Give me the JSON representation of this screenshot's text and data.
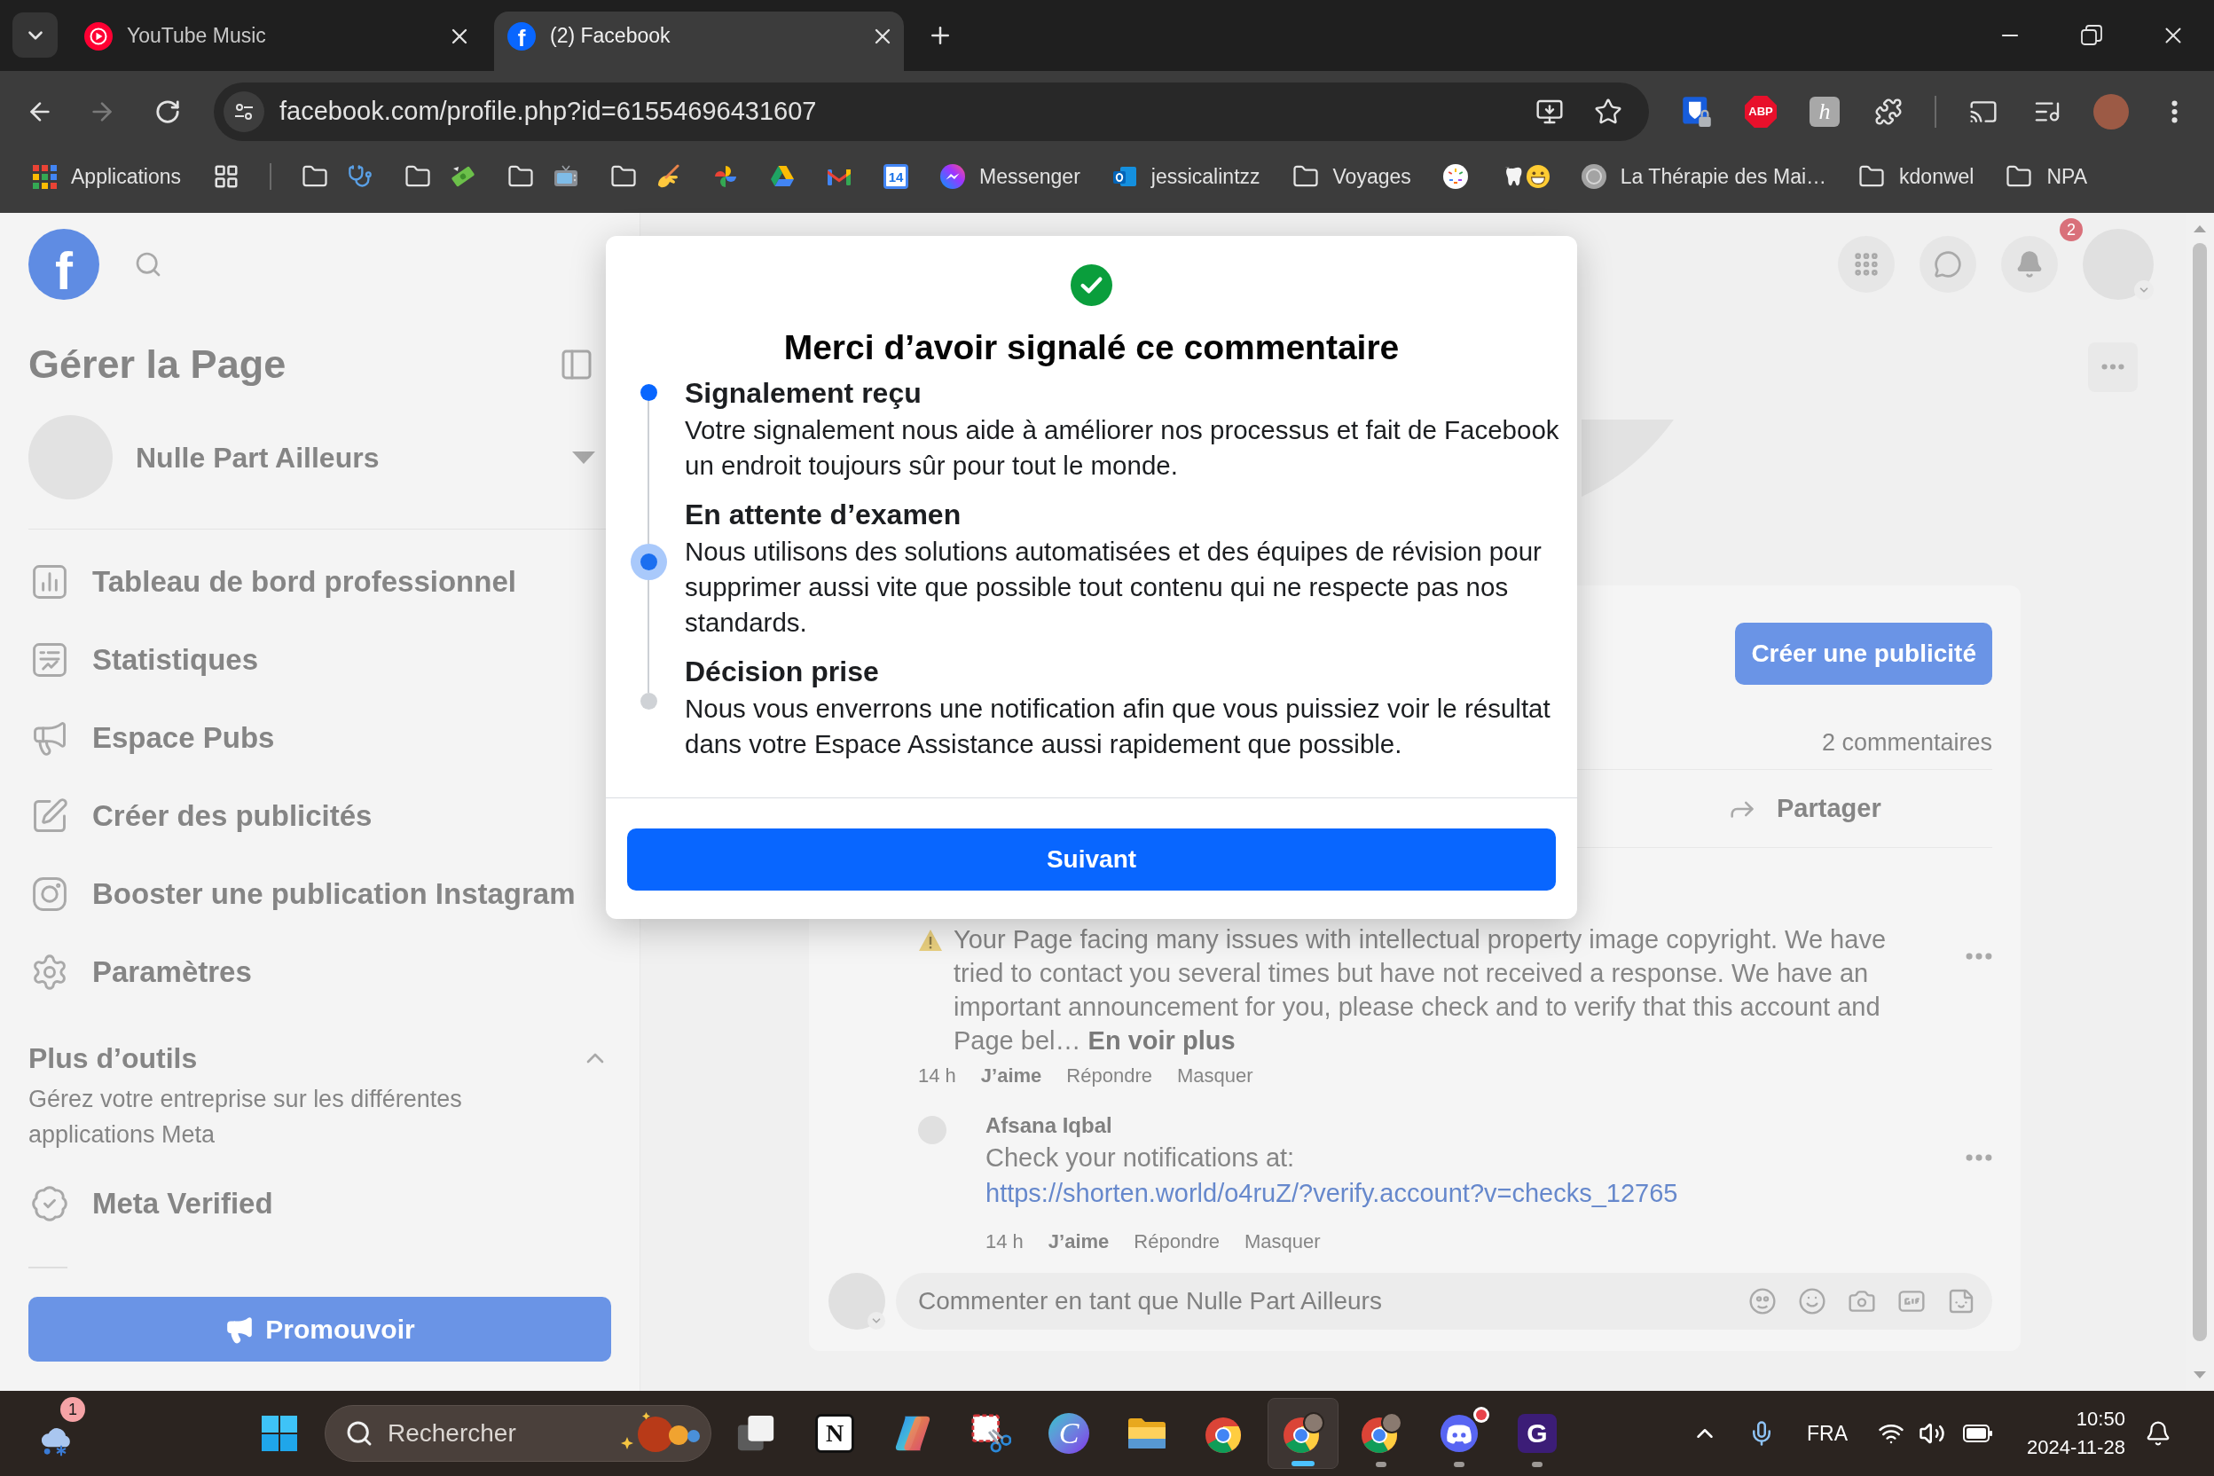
{
  "browser": {
    "tabs": [
      {
        "title": "YouTube Music",
        "selected": false
      },
      {
        "title": "(2) Facebook",
        "selected": true,
        "glyph": "f"
      }
    ],
    "forward": {
      "disabled": true
    },
    "url": "facebook.com/profile.php?id=61554696431607",
    "extensions": [
      {
        "kind": "vault"
      },
      {
        "kind": "octagon",
        "glyph": "ABP"
      },
      {
        "kind": "tile",
        "glyph": "h"
      },
      {
        "kind": "puzzle"
      }
    ],
    "bookmarks": [
      {
        "kind": "apps",
        "label": "Applications"
      },
      {
        "kind": "groups"
      },
      {
        "kind": "separator"
      },
      {
        "kind": "folder"
      },
      {
        "kind": "folder"
      },
      {
        "kind": "folder"
      },
      {
        "kind": "folder"
      },
      {
        "kind": "site"
      },
      {
        "kind": "site"
      },
      {
        "kind": "site"
      },
      {
        "kind": "site",
        "glyph": "14"
      },
      {
        "kind": "site",
        "label": "Messenger"
      },
      {
        "kind": "site",
        "label": "jessicalintzz"
      },
      {
        "kind": "folder",
        "label": "Voyages"
      },
      {
        "kind": "site"
      },
      {
        "kind": "site"
      },
      {
        "kind": "site",
        "label": "La Thérapie des Mai…"
      },
      {
        "kind": "folder",
        "label": "kdonwel"
      },
      {
        "kind": "folder",
        "label": "NPA"
      }
    ]
  },
  "page": {
    "sidebar": {
      "logo_glyph": "f",
      "title": "Gérer la Page",
      "page_name": "Nulle Part Ailleurs",
      "items": [
        "Tableau de bord professionnel",
        "Statistiques",
        "Espace Pubs",
        "Créer des publicités",
        "Booster une publication Instagram",
        "Paramètres"
      ],
      "more_tools": {
        "title": "Plus d’outils",
        "expanded": true,
        "description": "Gérez votre entreprise sur les différentes applications Meta",
        "items": [
          "Meta Verified"
        ]
      },
      "promote_button": "Promouvoir"
    },
    "header": {
      "notification_count": "2"
    },
    "post": {
      "create_ad_button": "Créer une publicité",
      "comment_count": "2 commentaires",
      "share_button": "Partager",
      "comments": [
        {
          "text": "Your Page facing many issues with intellectual property image copyright. We have tried to contact you several times but have not received a response. We have an important announcement for you, please check and to verify that this account and Page bel…",
          "see_more": "En voir plus",
          "time": "14 h",
          "actions": [
            "J’aime",
            "Répondre",
            "Masquer"
          ],
          "replies": [
            {
              "author": "Afsana Iqbal",
              "text": "Check your notifications at:",
              "link": "https://shorten.world/o4ruZ/?verify.account?v=checks_12765",
              "time": "14 h",
              "actions": [
                "J’aime",
                "Répondre",
                "Masquer"
              ]
            }
          ]
        }
      ],
      "composer": {
        "placeholder": "Commenter en tant que Nulle Part Ailleurs"
      }
    }
  },
  "dialog": {
    "title": "Merci d’avoir signalé ce commentaire",
    "steps": [
      {
        "title": "Signalement reçu",
        "body": "Votre signalement nous aide à améliorer nos processus et fait de Facebook un endroit toujours sûr pour tout le monde.",
        "completed": true,
        "current": false
      },
      {
        "title": "En attente d’examen",
        "body": "Nous utilisons des solutions automatisées et des équipes de révision pour supprimer aussi vite que possible tout contenu qui ne respecte pas nos standards.",
        "completed": false,
        "current": true
      },
      {
        "title": "Décision prise",
        "body": "Nous vous enverrons une notification afin que vous puissiez voir le résultat dans votre Espace Assistance aussi rapidement que possible.",
        "completed": false,
        "current": false
      }
    ],
    "button": "Suivant"
  },
  "taskbar": {
    "weather_badge": "1",
    "search": {
      "placeholder": "Rechercher"
    },
    "apps": [
      {
        "kind": "squares",
        "running": false,
        "selected": false
      },
      {
        "kind": "tile",
        "glyph": "N",
        "running": false,
        "selected": false
      },
      {
        "kind": "swirl",
        "running": false,
        "selected": false
      },
      {
        "kind": "snip",
        "running": false,
        "selected": false
      },
      {
        "kind": "disc",
        "glyph": "C",
        "running": false,
        "selected": false
      },
      {
        "kind": "folder",
        "running": false,
        "selected": false
      },
      {
        "kind": "browser",
        "running": false,
        "selected": false
      },
      {
        "kind": "profile",
        "running": true,
        "selected": true
      },
      {
        "kind": "profile",
        "running": true,
        "selected": false
      },
      {
        "kind": "chat",
        "running": true,
        "selected": false,
        "badge": true
      },
      {
        "kind": "darktile",
        "glyph": "G",
        "running": true,
        "selected": false
      }
    ],
    "language": "FRA",
    "time": "10:50",
    "date": "2024-11-28"
  }
}
